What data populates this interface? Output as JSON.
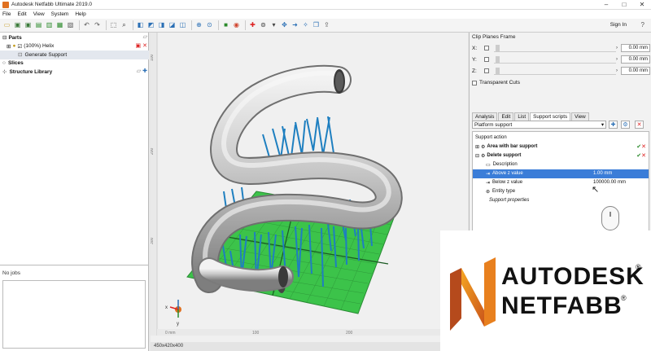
{
  "window": {
    "title": "Autodesk Netfabb Ultimate 2019.0"
  },
  "menu": [
    "File",
    "Edit",
    "View",
    "System",
    "Help"
  ],
  "toolbar": {
    "sign_in": "Sign In"
  },
  "tree": {
    "parts_label": "Parts",
    "part_name": "(100%) Helix",
    "generate_support": "Generate Support",
    "slices_label": "Slices",
    "structure_library": "Structure Library"
  },
  "jobs": {
    "header": "No jobs"
  },
  "viewport": {
    "status": "450x420x400",
    "ruler_left": [
      "100",
      "200",
      "300"
    ],
    "ruler_bottom": [
      "0 mm",
      "100",
      "200"
    ],
    "axis_x": "x",
    "axis_y": "y"
  },
  "clip_planes": {
    "title": "Clip Planes Frame",
    "rows": [
      {
        "axis": "X:",
        "value": "0.00 mm"
      },
      {
        "axis": "Y:",
        "value": "0.00 mm"
      },
      {
        "axis": "Z:",
        "value": "0.00 mm"
      }
    ],
    "transparent_cuts": "Transparent Cuts"
  },
  "tabs": [
    "Analysis",
    "Edit",
    "List",
    "Support scripts",
    "View"
  ],
  "active_tab": "Support scripts",
  "platform_select": "Platform support",
  "support": {
    "action_label": "Support action",
    "area_bar": "Area with bar support",
    "delete_support": "Delete support",
    "description": "Description",
    "above_z": "Above z value",
    "above_z_value": "1.00 mm",
    "below_z": "Below z value",
    "below_z_value": "100000.00 mm",
    "entity_type": "Entity type",
    "support_properties": "Support properties"
  },
  "brand": {
    "line1": "AUTODESK",
    "line2": "NETFABB",
    "reg": "®"
  },
  "colors": {
    "accent": "#3b7dd8",
    "platform": "#3cc34a",
    "supports": "#1e7fc0",
    "brand_orange": "#e8801e"
  }
}
